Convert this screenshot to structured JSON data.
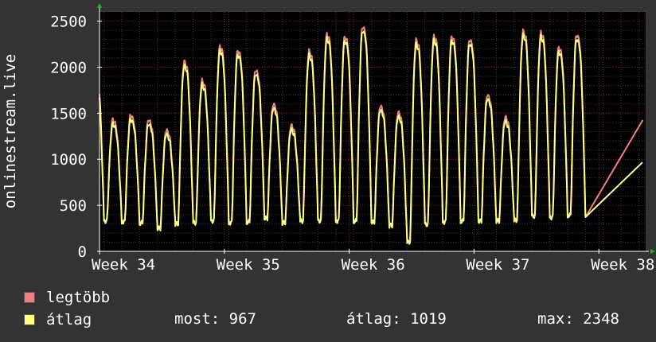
{
  "chart_data": {
    "type": "line",
    "ylabel": "onlinestream.live",
    "ylim": [
      0,
      2600
    ],
    "yticks": [
      0,
      500,
      1000,
      1500,
      2000,
      2500
    ],
    "xticks": [
      "Week 34",
      "Week 35",
      "Week 36",
      "Week 37",
      "Week 38"
    ],
    "grid": true,
    "x_unit": "days since start of Week 34",
    "daily_peaks": [
      1960,
      1390,
      1440,
      1390,
      1280,
      2020,
      1810,
      2180,
      2140,
      1930,
      1560,
      1330,
      2130,
      2310,
      2290,
      2400,
      1540,
      1470,
      2250,
      2290,
      2290,
      2260,
      1660,
      1420,
      2350,
      2330,
      2170,
      2310
    ],
    "daily_troughs": [
      240,
      330,
      320,
      310,
      250,
      300,
      310,
      330,
      310,
      320,
      360,
      310,
      330,
      330,
      330,
      330,
      320,
      280,
      100,
      290,
      320,
      330,
      330,
      330,
      340,
      380,
      370,
      390
    ],
    "series": [
      {
        "name": "legtöbb",
        "color": "#f08080",
        "offset": 45
      },
      {
        "name": "átlag",
        "color": "#ffff80",
        "offset": 0
      }
    ],
    "current_value": 967,
    "end_max_value": 1420
  },
  "legend": {
    "max_label": "legtöbb",
    "avg_label": "átlag",
    "most_text": "most: 967",
    "atlag_text": "átlag: 1019",
    "max_text": "max: 2348"
  }
}
